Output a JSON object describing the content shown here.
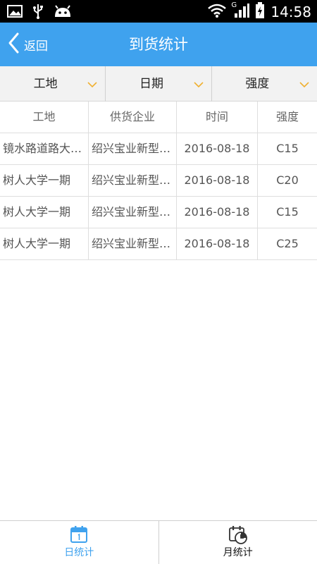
{
  "status_bar": {
    "time": "14:58",
    "network": "G",
    "icons": [
      "image-icon",
      "usb-icon",
      "android-icon",
      "wifi-icon",
      "signal-icon",
      "battery-charging-icon"
    ]
  },
  "header": {
    "back_label": "返回",
    "title": "到货统计"
  },
  "filters": [
    {
      "label": "工地"
    },
    {
      "label": "日期"
    },
    {
      "label": "强度"
    }
  ],
  "table": {
    "columns": [
      "工地",
      "供货企业",
      "时间",
      "强度"
    ],
    "rows": [
      {
        "site": "镜水路道路大…",
        "supplier": "绍兴宝业新型…",
        "date": "2016-08-18",
        "grade": "C15"
      },
      {
        "site": "树人大学一期",
        "supplier": "绍兴宝业新型…",
        "date": "2016-08-18",
        "grade": "C20"
      },
      {
        "site": "树人大学一期",
        "supplier": "绍兴宝业新型…",
        "date": "2016-08-18",
        "grade": "C15"
      },
      {
        "site": "树人大学一期",
        "supplier": "绍兴宝业新型…",
        "date": "2016-08-18",
        "grade": "C25"
      }
    ]
  },
  "tabs": [
    {
      "label": "日统计",
      "icon": "calendar-day-icon",
      "active": true
    },
    {
      "label": "月统计",
      "icon": "calendar-clock-icon",
      "active": false
    }
  ],
  "colors": {
    "accent": "#3fa2ee",
    "chevron": "#f0b030"
  }
}
